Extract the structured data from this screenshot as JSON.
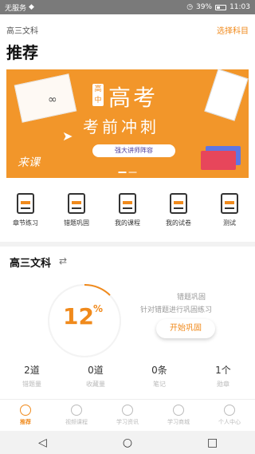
{
  "status": {
    "left_text": "无服务",
    "battery": "39%",
    "time": "11:03"
  },
  "header": {
    "subject": "高三文科",
    "select_subject": "选择科目",
    "title": "推荐"
  },
  "banner": {
    "tag": "高中",
    "headline": "高考",
    "subheadline": "考前冲刺",
    "pill": "强大讲师阵容",
    "logo": "来课"
  },
  "quick_entries": [
    {
      "label": "章节练习",
      "icon": "clipboard-icon"
    },
    {
      "label": "错题巩固",
      "icon": "error-notes-icon"
    },
    {
      "label": "我的课程",
      "icon": "course-folder-icon"
    },
    {
      "label": "我的试卷",
      "icon": "exam-paper-icon"
    },
    {
      "label": "测试",
      "icon": "calculator-icon"
    }
  ],
  "section": {
    "title": "高三文科",
    "progress_value": "12",
    "progress_unit": "%",
    "review_title": "错题巩固",
    "review_sub": "针对错题进行巩固练习",
    "review_button": "开始巩固"
  },
  "stats": [
    {
      "value": "2道",
      "label": "错题量"
    },
    {
      "value": "0道",
      "label": "收藏量"
    },
    {
      "value": "0条",
      "label": "笔记"
    },
    {
      "value": "1个",
      "label": "勋章"
    }
  ],
  "tabs": [
    {
      "label": "推荐",
      "active": true
    },
    {
      "label": "视频课程",
      "active": false
    },
    {
      "label": "学习资讯",
      "active": false
    },
    {
      "label": "学习商城",
      "active": false
    },
    {
      "label": "个人中心",
      "active": false
    }
  ],
  "colors": {
    "accent": "#f08a1c",
    "banner": "#f2962a"
  }
}
